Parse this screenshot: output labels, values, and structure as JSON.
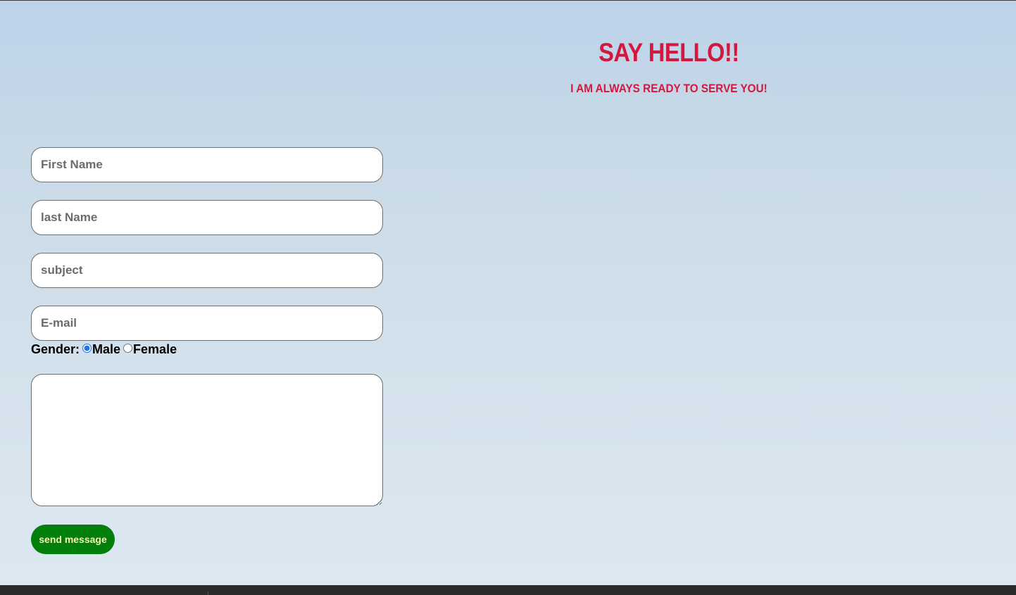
{
  "header": {
    "title": "SAY HELLO!!",
    "subtitle": "I AM ALWAYS READY TO SERVE YOU!"
  },
  "form": {
    "first_name": {
      "placeholder": "First Name",
      "value": ""
    },
    "last_name": {
      "placeholder": "last Name",
      "value": ""
    },
    "subject": {
      "placeholder": "subject",
      "value": ""
    },
    "email": {
      "placeholder": "E-mail",
      "value": ""
    },
    "gender": {
      "label": "Gender:",
      "options": [
        {
          "label": "Male",
          "selected": true
        },
        {
          "label": "Female",
          "selected": false
        }
      ]
    },
    "message": {
      "placeholder": "",
      "value": ""
    },
    "submit_label": "send message"
  },
  "colors": {
    "heading": "#d3173e",
    "button_bg": "#03800b",
    "button_text": "#f2f2b0",
    "radio_accent": "#1a73e8"
  }
}
